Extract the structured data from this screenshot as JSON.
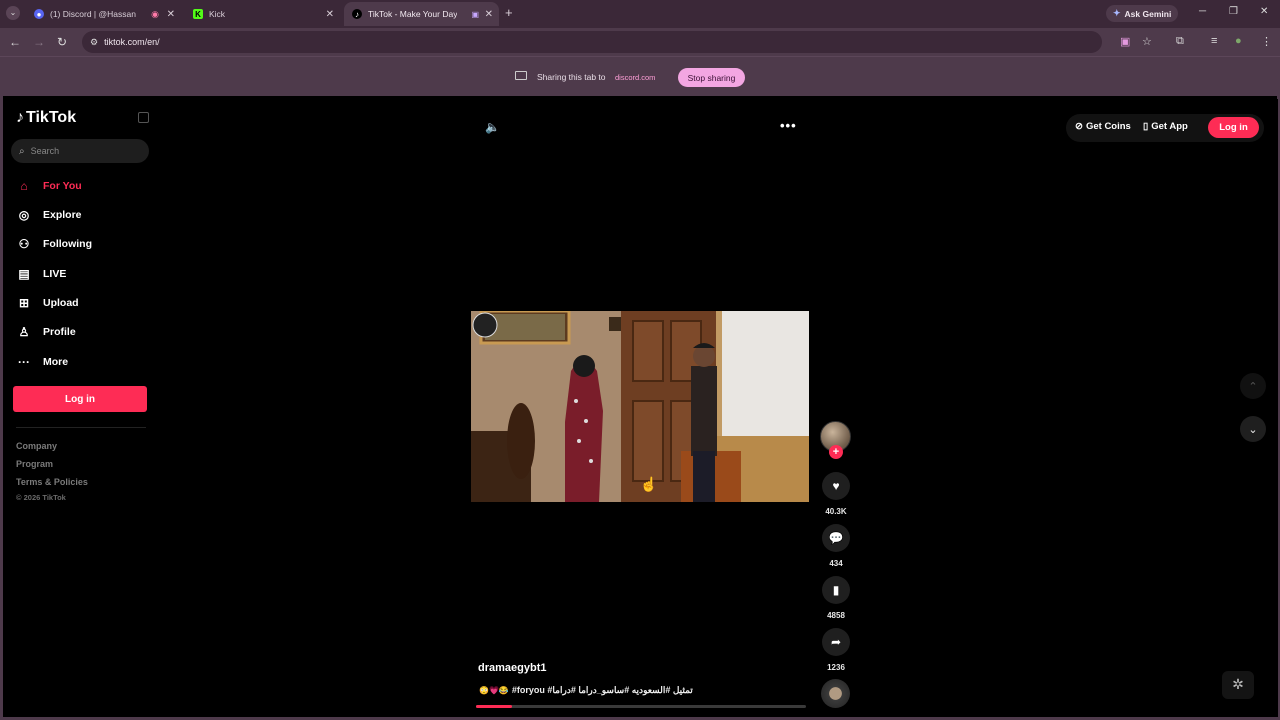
{
  "browser": {
    "tabs": [
      {
        "title": "(1) Discord | @Hassan",
        "icon": "discord-icon",
        "active": false
      },
      {
        "title": "Kick",
        "icon": "kick-icon",
        "active": false
      },
      {
        "title": "TikTok - Make Your Day",
        "icon": "tiktok-icon",
        "active": true
      }
    ],
    "ask_gemini": "Ask Gemini",
    "url": "tiktok.com/en/",
    "share_bar": {
      "text": "Sharing this tab to",
      "site": "discord.com",
      "stop_label": "Stop sharing"
    }
  },
  "tiktok": {
    "logo": "TikTok",
    "search_placeholder": "Search",
    "nav": [
      {
        "label": "For You",
        "icon": "home-icon",
        "active": true
      },
      {
        "label": "Explore",
        "icon": "compass-icon",
        "active": false
      },
      {
        "label": "Following",
        "icon": "following-icon",
        "active": false
      },
      {
        "label": "LIVE",
        "icon": "live-icon",
        "active": false
      },
      {
        "label": "Upload",
        "icon": "upload-icon",
        "active": false
      },
      {
        "label": "Profile",
        "icon": "profile-icon",
        "active": false
      },
      {
        "label": "More",
        "icon": "more-icon",
        "active": false
      }
    ],
    "login_side": "Log in",
    "footer": [
      "Company",
      "Program",
      "Terms & Policies"
    ],
    "copyright": "© 2026 TikTok",
    "top_actions": {
      "get_coins": "Get Coins",
      "get_app": "Get App",
      "login": "Log in"
    },
    "video": {
      "username": "dramaegybt1",
      "caption": "#foryou #تمثيل #السعوديه #ساسو_دراما #دراما",
      "likes": "40.3K",
      "comments": "434",
      "saves": "4858",
      "shares": "1236",
      "progress": 0.11
    }
  },
  "colors": {
    "accent": "#fe2c55",
    "chrome": "#4e3a4b",
    "chrome_dark": "#3b2838"
  }
}
